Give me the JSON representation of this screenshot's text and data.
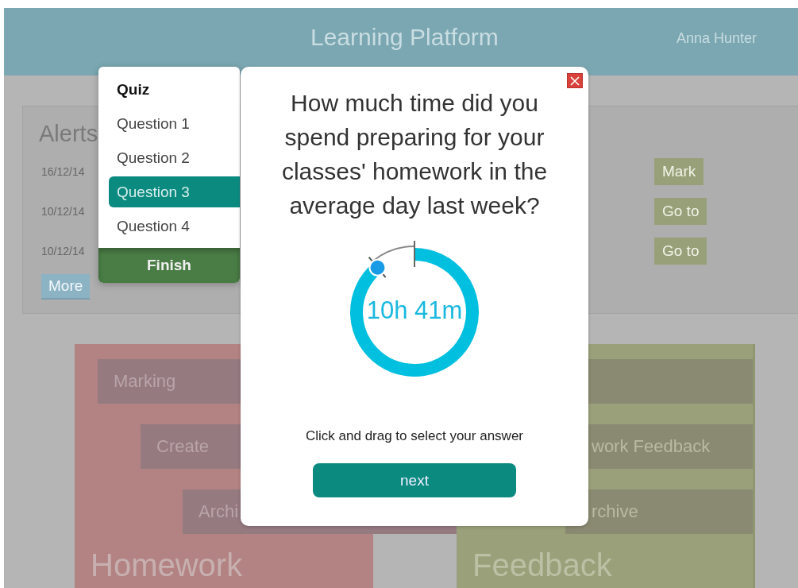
{
  "header": {
    "title": "Learning Platform",
    "user": "Anna Hunter"
  },
  "alerts": {
    "title": "Alerts",
    "rows": [
      {
        "date": "16/12/14",
        "action": "Mark"
      },
      {
        "date": "10/12/14",
        "action": "Go to"
      },
      {
        "date": "10/12/14",
        "action": "Go to"
      }
    ],
    "more": "More"
  },
  "cards": [
    {
      "kind": "homework",
      "title": "Homework",
      "buttons": [
        "Marking",
        "Create",
        "Archi"
      ]
    },
    {
      "kind": "feedback",
      "title": "Feedback",
      "buttons": [
        "work Feedback",
        "rchive"
      ]
    }
  ],
  "quiz_menu": {
    "title": "Quiz",
    "items": [
      {
        "label": "Question 1",
        "selected": false
      },
      {
        "label": "Question 2",
        "selected": false
      },
      {
        "label": "Question 3",
        "selected": true
      },
      {
        "label": "Question 4",
        "selected": false
      }
    ],
    "finish": "Finish"
  },
  "dialog": {
    "question": "How much time did you spend preparing for your classes' homework in the average day last week?",
    "dial": {
      "level": 0.89,
      "reading": "10h 41m"
    },
    "hint": "Click and drag to select your answer",
    "next": "next"
  }
}
